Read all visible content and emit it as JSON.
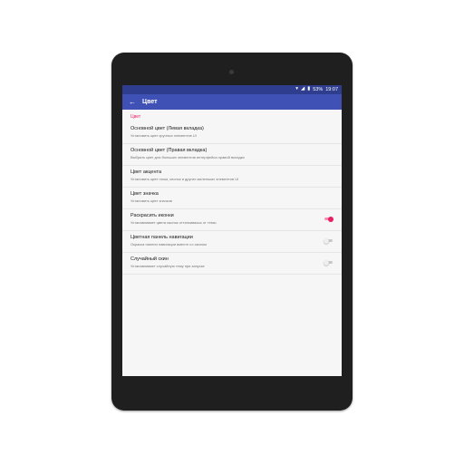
{
  "status_bar": {
    "battery": "53%",
    "time": "19:07",
    "icons": [
      "wifi-icon",
      "signal-icon",
      "battery-icon"
    ]
  },
  "app_bar": {
    "back_icon": "arrow-back-icon",
    "title": "Цвет"
  },
  "section": {
    "header": "Цвет"
  },
  "preferences": [
    {
      "title": "Основной цвет (Левая вкладка)",
      "summary": "Установить цвет крупных элементов UI"
    },
    {
      "title": "Основной цвет (Правая вкладка)",
      "summary": "Выбрать цвет для больших элементов интерфейса правой вкладки"
    },
    {
      "title": "Цвет акцента",
      "summary": "Установить цвет плом, кнопок и других маленьких элементов UI"
    },
    {
      "title": "Цвет значка",
      "summary": "Установить цвет значков"
    },
    {
      "title": "Раскрасить иконки",
      "summary": "Устанавливает цвета иконок отталкиваясь от темы",
      "switch_on": true
    },
    {
      "title": "Цветная панель навигации",
      "summary": "Окраска панели навигации вместе со скином",
      "switch_on": false
    },
    {
      "title": "Случайный скин",
      "summary": "Устанавливает случайную тему при запуске",
      "switch_on": false
    }
  ],
  "colors": {
    "primary": "#3f51b5",
    "primary_dark": "#2f3d8f",
    "accent": "#e91e63"
  }
}
